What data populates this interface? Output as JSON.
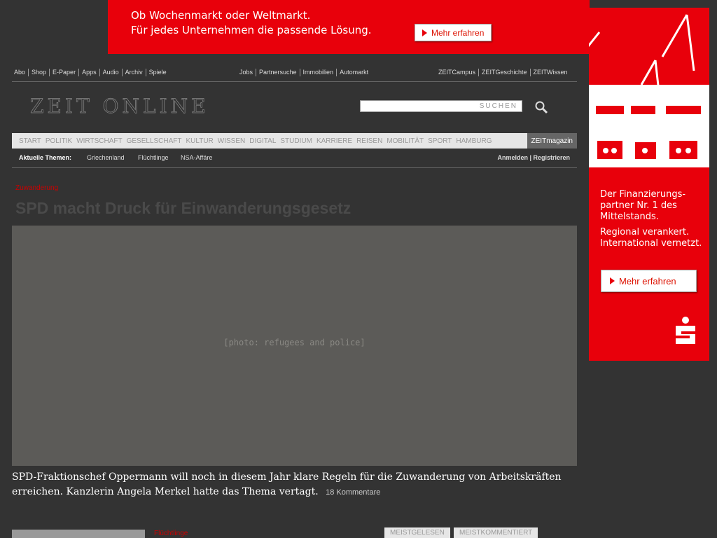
{
  "top_ad": {
    "line1": "Ob Wochenmarkt oder Weltmarkt.",
    "line2": "Für jedes Unternehmen die passende Lösung.",
    "button": "Mehr erfahren"
  },
  "side_ad": {
    "text1_l1": "Der Finanzierungs-",
    "text1_l2": "partner Nr. 1 des",
    "text1_l3": "Mittelstands.",
    "text2_l1": "Regional verankert.",
    "text2_l2": "International vernetzt.",
    "button": "Mehr erfahren"
  },
  "topnav": {
    "left": [
      "Abo",
      "Shop",
      "E-Paper",
      "Apps",
      "Audio",
      "Archiv",
      "Spiele"
    ],
    "middle": [
      "Jobs",
      "Partnersuche",
      "Immobilien",
      "Automarkt"
    ],
    "right": [
      "ZEITCampus",
      "ZEITGeschichte",
      "ZEITWissen"
    ]
  },
  "logo": "ZEIT ONLINE",
  "search": {
    "placeholder": "SUCHEN"
  },
  "categories": [
    "START",
    "POLITIK",
    "WIRTSCHAFT",
    "GESELLSCHAFT",
    "KULTUR",
    "WISSEN",
    "DIGITAL",
    "STUDIUM",
    "KARRIERE",
    "REISEN",
    "MOBILITÄT",
    "SPORT",
    "HAMBURG"
  ],
  "zeitmagazin": "ZEITmagazin",
  "themes": {
    "label": "Aktuelle Themen:",
    "items": [
      "Griechenland",
      "Flüchtlinge",
      "NSA-Affäre"
    ],
    "login": "Anmelden | Registrieren"
  },
  "article": {
    "kicker": "Zuwanderung",
    "headline": "SPD macht Druck für Einwanderungsgesetz",
    "photo_alt": "[photo: refugees and police]",
    "lead_l1": "SPD-Fraktionschef Oppermann will noch in diesem Jahr klare Regeln für die Zuwanderung von Arbeitskräften",
    "lead_l2": "erreichen. Kanzlerin Angela Merkel hatte das Thema vertagt.",
    "comments": "18 Kommentare"
  },
  "second_kicker": "Flüchtlinge",
  "tabs": [
    "MEISTGELESEN",
    "MEISTKOMMENTIERT"
  ],
  "colors": {
    "ad_red": "#e8000b",
    "kicker_red": "#c00000"
  }
}
